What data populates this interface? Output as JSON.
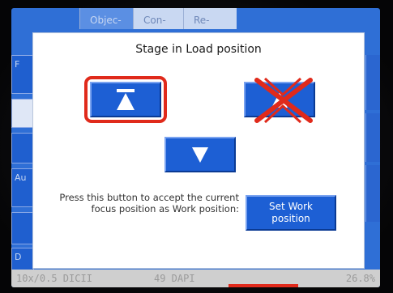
{
  "background": {
    "tabs": [
      "Objec-",
      "Con-",
      "Re-"
    ],
    "left_buttons": [
      "F",
      "",
      "",
      "Au",
      "",
      "D"
    ]
  },
  "dialog": {
    "title": "Stage in Load position",
    "help_text": "Press this button to accept the current focus position as Work position:",
    "set_work_button": "Set Work position",
    "buttons": {
      "up_load_icon": "triangle-up-with-bar-icon",
      "up_work_icon": "triangle-up-icon",
      "down_icon": "triangle-down-icon"
    }
  },
  "statusbar": {
    "objective": "10x/0.5 DICII",
    "filter": "49 DAPI",
    "percent": "26.8%"
  },
  "colors": {
    "screen_blue": "#2f6fd6",
    "button_blue": "#1d5fd4",
    "annotation_red": "#e02a1b",
    "statusbar_gray": "#cfcfcf"
  }
}
